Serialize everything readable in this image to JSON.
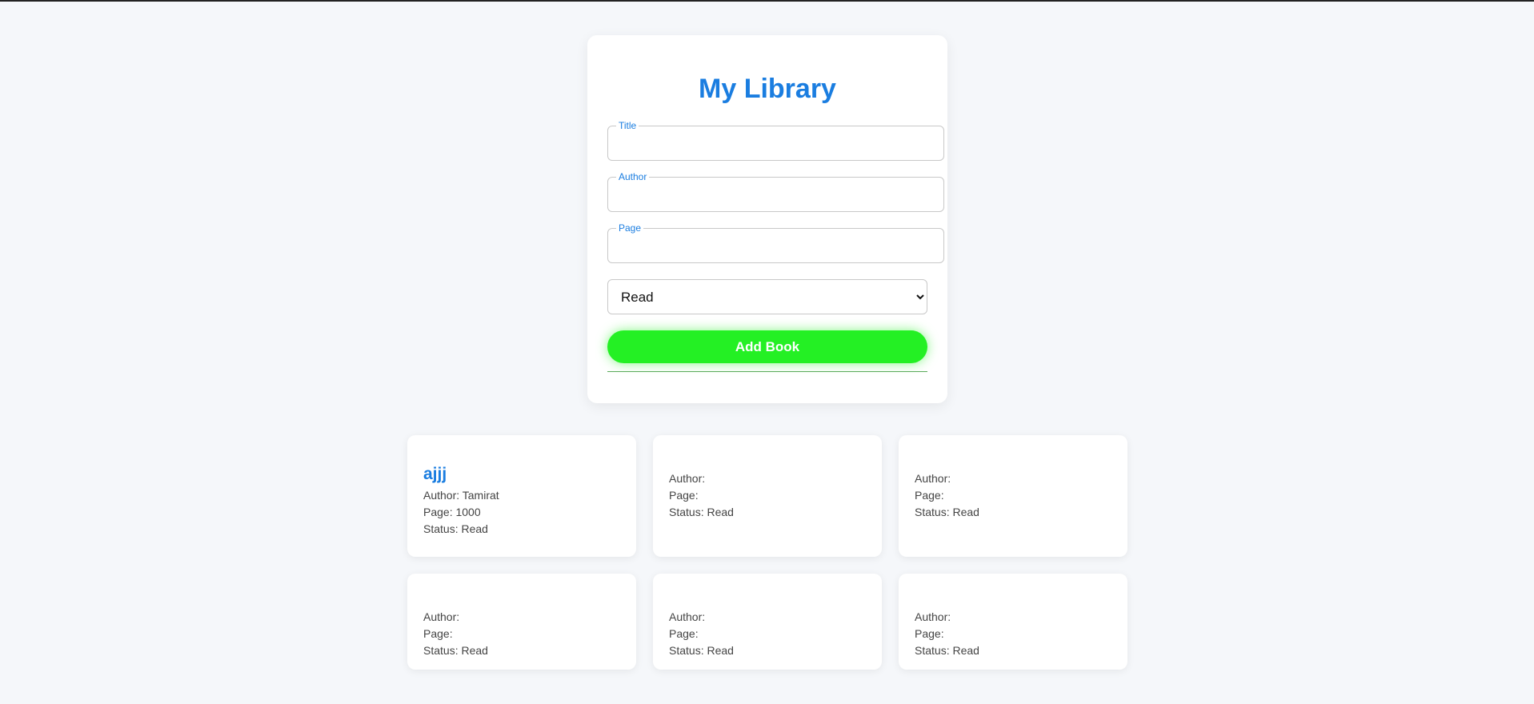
{
  "app": {
    "title": "My Library"
  },
  "form": {
    "title_label": "Title",
    "title_value": "",
    "author_label": "Author",
    "author_value": "",
    "page_label": "Page",
    "page_value": "",
    "status_options": [
      "Read"
    ],
    "status_selected": "Read",
    "submit_label": "Add Book"
  },
  "colors": {
    "accent": "#1a7de0",
    "button": "#24f024",
    "background": "#f5f7fa"
  },
  "books": [
    {
      "title": "ajjj",
      "author_text": "Author: Tamirat",
      "page_text": "Page: 1000",
      "status_text": "Status: Read"
    },
    {
      "title": "",
      "author_text": "Author:",
      "page_text": "Page:",
      "status_text": "Status: Read"
    },
    {
      "title": "",
      "author_text": "Author:",
      "page_text": "Page:",
      "status_text": "Status: Read"
    },
    {
      "title": "",
      "author_text": "Author:",
      "page_text": "Page:",
      "status_text": "Status: Read"
    },
    {
      "title": "",
      "author_text": "Author:",
      "page_text": "Page:",
      "status_text": "Status: Read"
    },
    {
      "title": "",
      "author_text": "Author:",
      "page_text": "Page:",
      "status_text": "Status: Read"
    }
  ]
}
